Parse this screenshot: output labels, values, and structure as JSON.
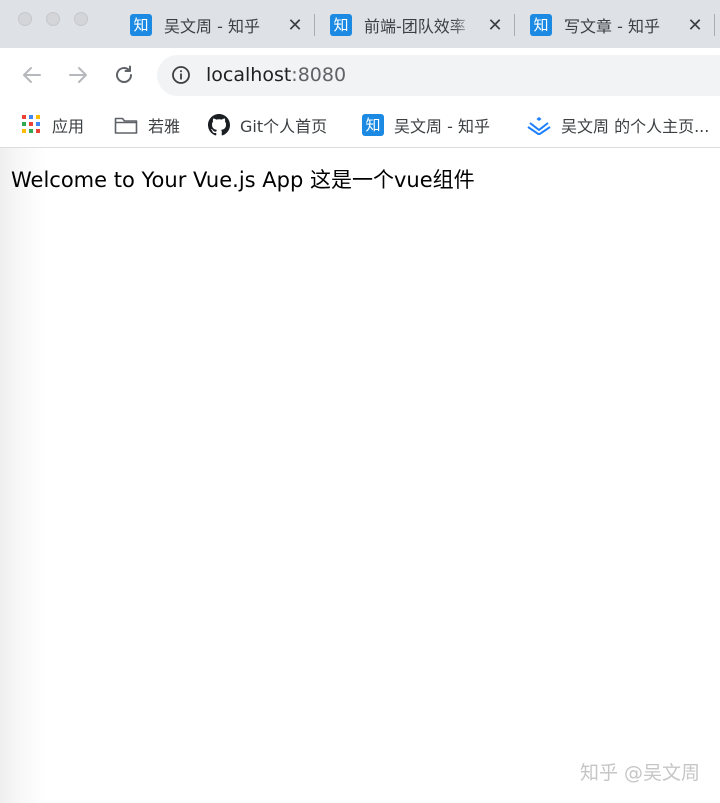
{
  "window": {
    "controls": [
      "close",
      "minimize",
      "zoom"
    ]
  },
  "tabs": [
    {
      "icon_text": "知",
      "title": "吴文周 - 知乎",
      "close": "✕"
    },
    {
      "icon_text": "知",
      "title": "前端-团队效率",
      "close": "✕"
    },
    {
      "icon_text": "知",
      "title": "写文章 - 知乎",
      "close": "✕"
    }
  ],
  "toolbar": {
    "url_host": "localhost",
    "url_port": ":8080"
  },
  "bookmarks": [
    {
      "label": "应用",
      "icon": "apps-grid-icon"
    },
    {
      "label": "若雅",
      "icon": "folder-icon"
    },
    {
      "label": "Git个人首页",
      "icon": "github-icon"
    },
    {
      "label": "吴文周 - 知乎",
      "icon": "zhihu-icon",
      "icon_text": "知"
    },
    {
      "label": "吴文周 的个人主页...",
      "icon": "juejin-icon"
    }
  ],
  "page": {
    "text": "Welcome to Your Vue.js App 这是一个vue组件"
  },
  "watermark": "知乎 @吴文周",
  "colors": {
    "tabstrip_bg": "#dee1e6",
    "zhihu_blue": "#1c8ae3",
    "omnibox_bg": "#f1f3f4",
    "juejin_blue": "#1e80ff"
  }
}
